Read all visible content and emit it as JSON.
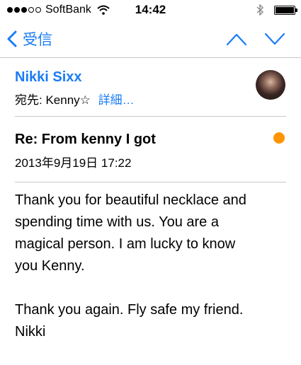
{
  "status_bar": {
    "carrier": "SoftBank",
    "time": "14:42"
  },
  "nav": {
    "back_label": "受信"
  },
  "message": {
    "sender": "Nikki Sixx",
    "to_label": "宛先:",
    "to_name": "Kenny☆",
    "details_label": "詳細…",
    "subject": "Re: From kenny I got",
    "date": "2013年9月19日 17:22",
    "flag_color": "#ff9500",
    "body": {
      "line1": "Thank you for beautiful necklace and",
      "line2": "spending time with us. You are a",
      "line3": "magical person.  I am lucky to know",
      "line4": "you Kenny.",
      "line5": "Thank you again. Fly safe my friend.",
      "line6": "Nikki"
    }
  },
  "colors": {
    "accent": "#1a7cf5",
    "separator": "#c8c7cc"
  },
  "icons": [
    "signal-dots-icon",
    "wifi-icon",
    "bluetooth-icon",
    "battery-icon",
    "chevron-left-icon",
    "chevron-up-icon",
    "chevron-down-icon"
  ]
}
